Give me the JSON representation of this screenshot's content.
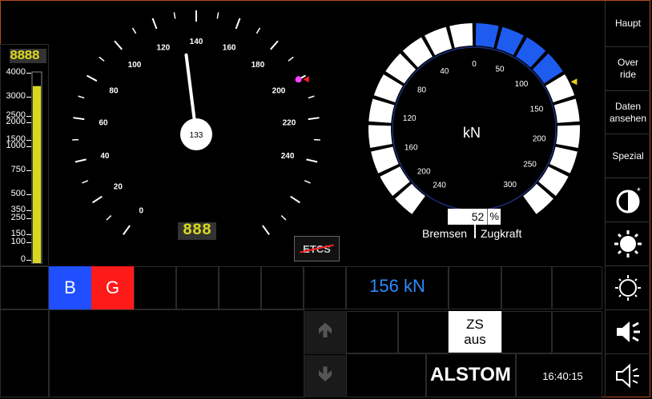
{
  "left_gauge": {
    "digits": "8888",
    "scale": [
      "4000",
      "3000",
      "2500",
      "2000",
      "1500",
      "1000",
      "750",
      "500",
      "350",
      "250",
      "150",
      "100",
      "0"
    ],
    "fill_fraction": 0.93,
    "color": "#d8d820"
  },
  "speedometer": {
    "ticks": [
      "0",
      "20",
      "40",
      "60",
      "80",
      "100",
      "120",
      "140",
      "160",
      "180",
      "200",
      "220",
      "240"
    ],
    "current_speed": "133",
    "speed_value": 133,
    "target_speed": 200,
    "digits": "888",
    "etcs_label": "ETCS"
  },
  "force_gauge": {
    "unit": "kN",
    "ticks_left": [
      "0",
      "40",
      "80",
      "120",
      "160",
      "200",
      "240"
    ],
    "ticks_right": [
      "50",
      "100",
      "150",
      "200",
      "250",
      "300"
    ],
    "percent_value": "52",
    "percent_sign": "%",
    "brake_label": "Bremsen",
    "traction_label": "Zugkraft",
    "active_color": "#1e5cf0"
  },
  "status": {
    "b_label": "B",
    "g_label": "G",
    "b_color": "#1f4fff",
    "g_color": "#ff1a1a",
    "force_value": "156 kN",
    "zs_line1": "ZS",
    "zs_line2": "aus",
    "brand": "ALSTOM",
    "time": "16:40:15"
  },
  "sidebar": {
    "haupt": "Haupt",
    "override_1": "Over",
    "override_2": "ride",
    "data_1": "Daten",
    "data_2": "ansehen",
    "spezial": "Spezial",
    "icons": [
      "contrast-icon",
      "brightness-up-icon",
      "brightness-down-icon",
      "volume-up-icon",
      "volume-down-icon"
    ]
  }
}
